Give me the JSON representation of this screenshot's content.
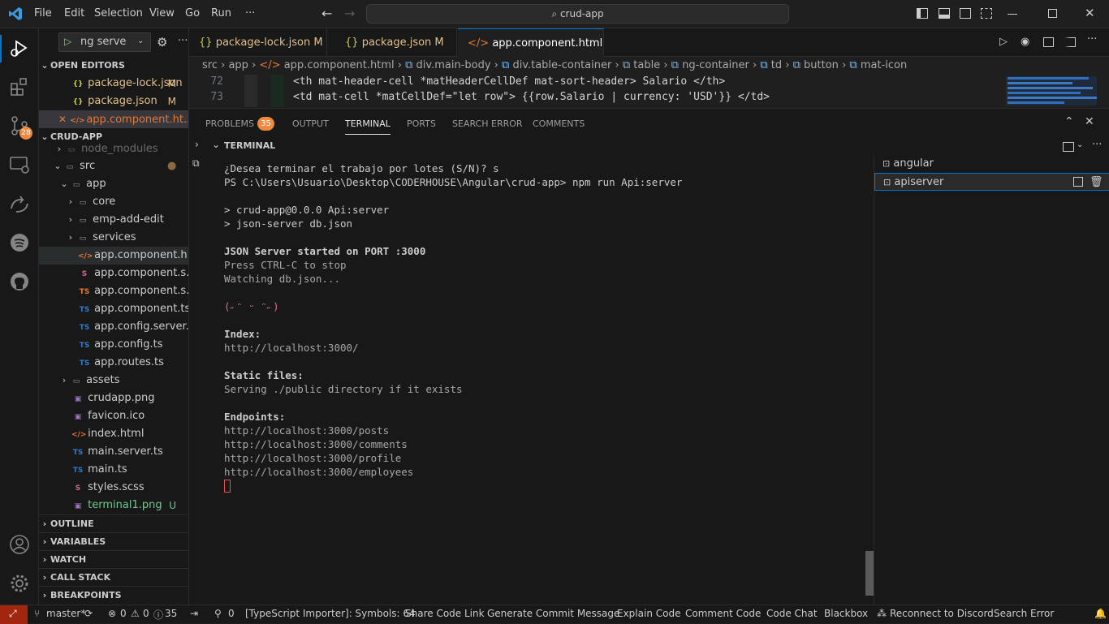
{
  "titlebar": {
    "menu": [
      "File",
      "Edit",
      "Selection",
      "View",
      "Go",
      "Run",
      "···"
    ],
    "search_text": "crud-app"
  },
  "activity": {
    "scm_badge": "28"
  },
  "sidebar": {
    "open_editors_label": "OPEN EDITORS",
    "open_editors": [
      {
        "name": "package-lock.json",
        "status": "M"
      },
      {
        "name": "package.json",
        "status": "M"
      },
      {
        "name": "app.component.ht...",
        "status": ""
      }
    ],
    "project_label": "CRUD-APP",
    "tree": [
      {
        "name": "node_modules"
      },
      {
        "name": "src"
      },
      {
        "name": "app"
      },
      {
        "name": "core"
      },
      {
        "name": "emp-add-edit"
      },
      {
        "name": "services"
      },
      {
        "name": "app.component.h..."
      },
      {
        "name": "app.component.s..."
      },
      {
        "name": "app.component.s..."
      },
      {
        "name": "app.component.ts"
      },
      {
        "name": "app.config.server.ts"
      },
      {
        "name": "app.config.ts"
      },
      {
        "name": "app.routes.ts"
      },
      {
        "name": "assets"
      },
      {
        "name": "crudapp.png"
      },
      {
        "name": "favicon.ico"
      },
      {
        "name": "index.html"
      },
      {
        "name": "main.server.ts"
      },
      {
        "name": "main.ts"
      },
      {
        "name": "styles.scss"
      },
      {
        "name": "terminal1.png",
        "status": "U"
      }
    ],
    "outline_label": "OUTLINE",
    "variables_label": "VARIABLES",
    "watch_label": "WATCH",
    "callstack_label": "CALL STACK",
    "breakpoints_label": "BREAKPOINTS"
  },
  "debug": {
    "config": "ng serve"
  },
  "tabs": [
    {
      "label": "package-lock.json",
      "status": "M"
    },
    {
      "label": "package.json",
      "status": "M"
    },
    {
      "label": "app.component.html",
      "close": "✕"
    }
  ],
  "breadcrumb": [
    "src",
    "app",
    "app.component.html",
    "div.main-body",
    "div.table-container",
    "table",
    "ng-container",
    "td",
    "button",
    "mat-icon"
  ],
  "code": [
    {
      "num": "72",
      "text": "<th mat-header-cell *matHeaderCellDef mat-sort-header> Salario </th>"
    },
    {
      "num": "73",
      "text": "<td mat-cell *matCellDef=\"let row\"> {{row.Salario | currency: 'USD'}} </td>"
    }
  ],
  "panel": {
    "tabs": [
      "PROBLEMS",
      "OUTPUT",
      "TERMINAL",
      "PORTS",
      "SEARCH ERROR",
      "COMMENTS"
    ],
    "problems_count": "35",
    "terminal_label": "TERMINAL"
  },
  "terminal": {
    "lines": [
      "¿Desea terminar el trabajo por lotes (S/N)? s",
      "PS C:\\Users\\Usuario\\Desktop\\CODERHOUSE\\Angular\\crud-app> npm run Api:server",
      "",
      "> crud-app@0.0.0 Api:server",
      "> json-server db.json",
      "",
      "JSON Server started on PORT :3000",
      "Press CTRL-C to stop",
      "Watching db.json...",
      "",
      "(˶ᵔ ᵕ ᵔ˶)",
      "",
      "Index:",
      "http://localhost:3000/",
      "",
      "Static files:",
      "Serving ./public directory if it exists",
      "",
      "Endpoints:",
      "http://localhost:3000/posts",
      "http://localhost:3000/comments",
      "http://localhost:3000/profile",
      "http://localhost:3000/employees"
    ],
    "instances": [
      "angular",
      "apiserver"
    ]
  },
  "statusbar": {
    "branch": "master*",
    "errors": "0",
    "warnings": "0",
    "info": "35",
    "ports": "0",
    "items": [
      "[TypeScript Importer]: Symbols: 64",
      "Share Code Link",
      "Generate Commit Message",
      "Explain Code",
      "Comment Code",
      "Code Chat",
      "Blackbox",
      "Reconnect to Discord",
      "Search Error"
    ]
  },
  "colors": {
    "accent": "#0078d4",
    "badge": "#f0883e",
    "modified": "#e2c08d",
    "untracked": "#73c991"
  }
}
